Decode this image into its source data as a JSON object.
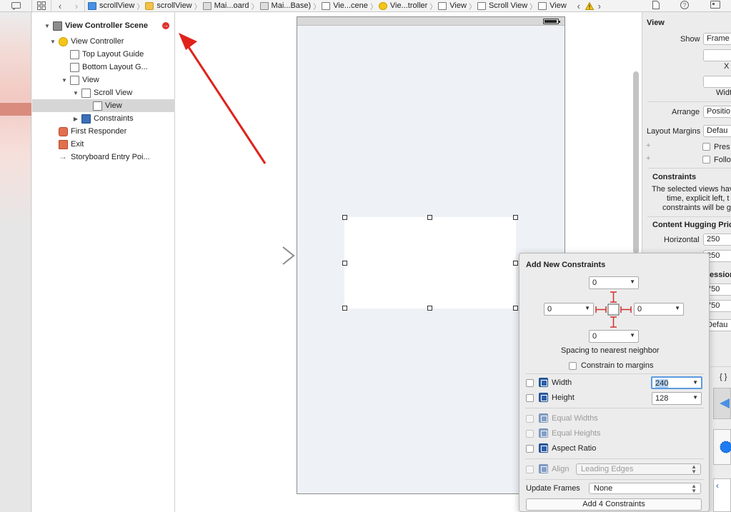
{
  "breadcrumbs": [
    {
      "label": "scrollView",
      "icon": "project-icon"
    },
    {
      "label": "scrollView",
      "icon": "folder-icon"
    },
    {
      "label": "Mai...oard",
      "icon": "storyboard-icon"
    },
    {
      "label": "Mai...Base)",
      "icon": "storyboard-icon"
    },
    {
      "label": "Vie...cene",
      "icon": "scene-icon"
    },
    {
      "label": "Vie...troller",
      "icon": "view-controller-icon"
    },
    {
      "label": "View",
      "icon": "view-icon"
    },
    {
      "label": "Scroll View",
      "icon": "view-icon"
    },
    {
      "label": "View",
      "icon": "view-icon"
    }
  ],
  "outline": {
    "scene": "View Controller Scene",
    "view_controller": "View Controller",
    "top_layout_guide": "Top Layout Guide",
    "bottom_layout_guide": "Bottom Layout G...",
    "view": "View",
    "scroll_view": "Scroll View",
    "inner_view": "View",
    "constraints": "Constraints",
    "first_responder": "First Responder",
    "exit": "Exit",
    "entry_point": "Storyboard Entry Poi..."
  },
  "inspector": {
    "section": "View",
    "show_label": "Show",
    "show_value": "Frame",
    "x_label": "X",
    "width_label": "Widt",
    "arrange_label": "Arrange",
    "arrange_value": "Positio",
    "layout_margins_label": "Layout Margins",
    "layout_margins_value": "Defau",
    "preserve_label": "Pres",
    "follow_label": "Follo",
    "constraints_title": "Constraints",
    "constraints_text_1": "The selected views hav",
    "constraints_text_2": "time, explicit left, t",
    "constraints_text_3": "constraints will be g",
    "hugging_title": "Content Hugging Prio",
    "horizontal_label": "Horizontal",
    "horizontal_value": "250",
    "vertical_value": "250",
    "compression_title": "ession",
    "comp_h_value": "750",
    "comp_v_value": "750",
    "default_value": "Defau",
    "braces": "{ }"
  },
  "constraints_popover": {
    "title": "Add New Constraints",
    "top": "0",
    "left": "0",
    "right": "0",
    "bottom": "0",
    "spacing_label": "Spacing to nearest neighbor",
    "constrain_margins": "Constrain to margins",
    "width_label": "Width",
    "width_value": "240",
    "height_label": "Height",
    "height_value": "128",
    "equal_widths": "Equal Widths",
    "equal_heights": "Equal Heights",
    "aspect_ratio": "Aspect Ratio",
    "align_label": "Align",
    "align_value": "Leading Edges",
    "update_frames_label": "Update Frames",
    "update_frames_value": "None",
    "add_button": "Add 4 Constraints"
  },
  "colors": {
    "accent": "#2b5fa8",
    "selection": "#d6d6d6",
    "warning": "#f5c518",
    "annotation_red": "#e0221b"
  }
}
